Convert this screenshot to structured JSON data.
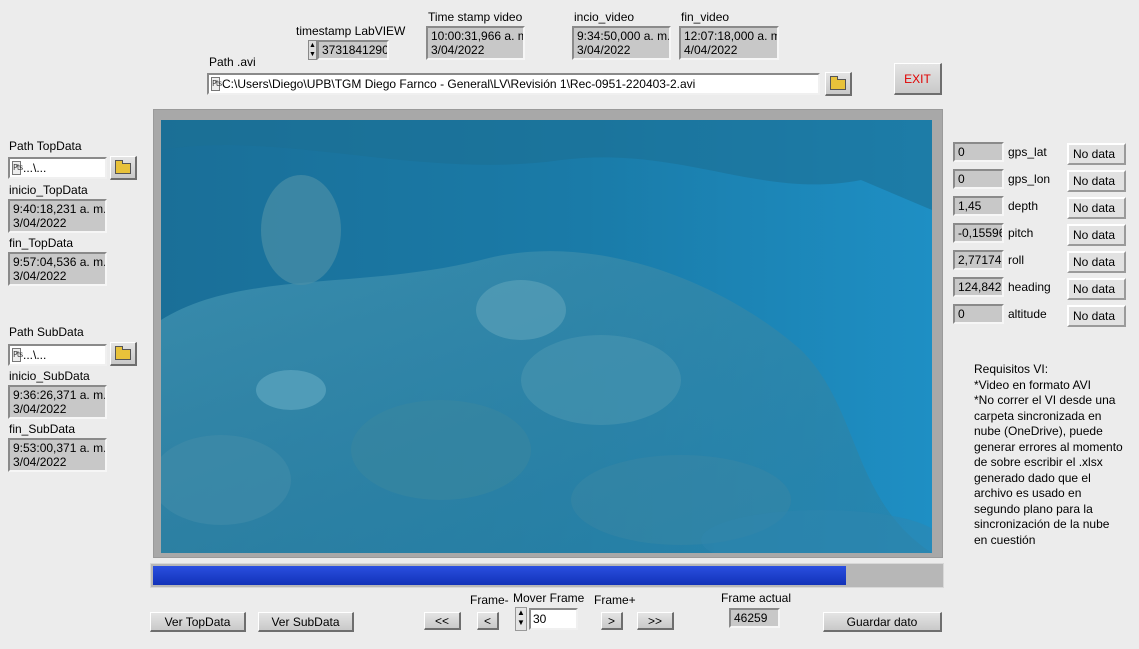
{
  "header": {
    "timestamp_labview": {
      "label": "timestamp LabVIEW",
      "value": "3731841290"
    },
    "timestamp_video": {
      "label": "Time stamp video",
      "line1": "10:00:31,966 a. m.",
      "line2": "3/04/2022"
    },
    "inicio_video": {
      "label": "incio_video",
      "line1": "9:34:50,000 a. m.",
      "line2": "3/04/2022"
    },
    "fin_video": {
      "label": "fin_video",
      "line1": "12:07:18,000 a. m.",
      "line2": "4/04/2022"
    },
    "exit_label": "EXIT"
  },
  "path_avi": {
    "label": "Path .avi",
    "value": "C:\\Users\\Diego\\UPB\\TGM Diego Farnco - General\\LV\\Revisión 1\\Rec-0951-220403-2.avi"
  },
  "top_data": {
    "path_label": "Path TopData",
    "path_value": "...\\...",
    "inicio_label": "inicio_TopData",
    "inicio_line1": "9:40:18,231 a. m.",
    "inicio_line2": "3/04/2022",
    "fin_label": "fin_TopData",
    "fin_line1": "9:57:04,536 a. m.",
    "fin_line2": "3/04/2022"
  },
  "sub_data": {
    "path_label": "Path SubData",
    "path_value": "...\\...",
    "inicio_label": "inicio_SubData",
    "inicio_line1": "9:36:26,371 a. m.",
    "inicio_line2": "3/04/2022",
    "fin_label": "fin_SubData",
    "fin_line1": "9:53:00,371 a. m.",
    "fin_line2": "3/04/2022"
  },
  "sensors": [
    {
      "value": "0",
      "name": "gps_lat",
      "status": "No data"
    },
    {
      "value": "0",
      "name": "gps_lon",
      "status": "No data"
    },
    {
      "value": "1,45",
      "name": "depth",
      "status": "No data"
    },
    {
      "value": "-0,15596",
      "name": "pitch",
      "status": "No data"
    },
    {
      "value": "2,77174",
      "name": "roll",
      "status": "No data"
    },
    {
      "value": "124,842",
      "name": "heading",
      "status": "No data"
    },
    {
      "value": "0",
      "name": "altitude",
      "status": "No data"
    }
  ],
  "notes": {
    "title": "Requisitos VI:",
    "line1": "*Video en formato AVI",
    "line2": "*No correr el VI desde una carpeta sincronizada en nube (OneDrive), puede generar errores al momento de sobre escribir el .xlsx generado dado que el archivo es usado en segundo plano para la sincronización de la nube en cuestión"
  },
  "progress": {
    "fraction": 0.88
  },
  "controls": {
    "ver_topdata": "Ver TopData",
    "ver_subdata": "Ver SubData",
    "frame_minus_label": "Frame-",
    "frame_plus_label": "Frame+",
    "mover_frame_label": "Mover Frame",
    "mover_frame_value": "30",
    "rewind": "<<",
    "prev": "<",
    "next": ">",
    "forward": ">>",
    "frame_actual_label": "Frame actual",
    "frame_actual_value": "46259",
    "guardar": "Guardar dato"
  },
  "colors": {
    "exit_text": "#e00000",
    "progress_fill": "#1a3fd0",
    "progress_track": "#b7b7b7"
  }
}
